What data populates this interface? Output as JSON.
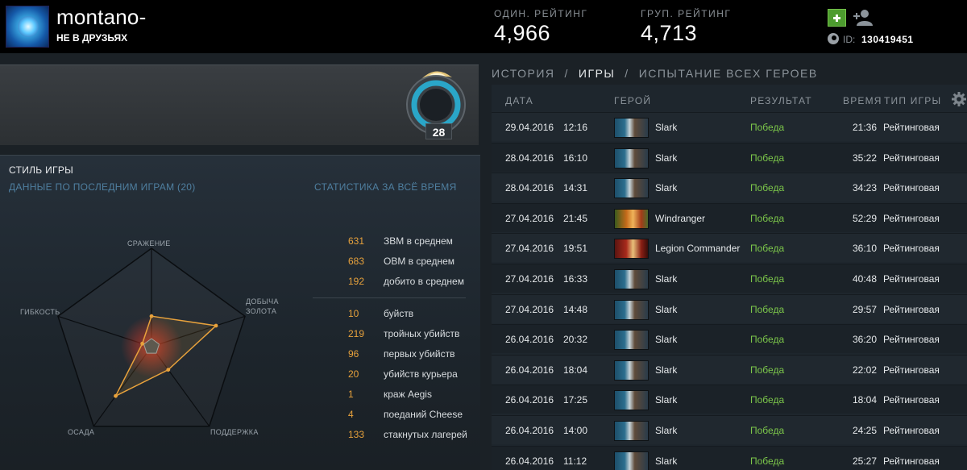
{
  "header": {
    "username": "montano-",
    "friend_status": "НЕ В ДРУЗЬЯХ",
    "solo_rating_label": "ОДИН. РЕЙТИНГ",
    "solo_rating_value": "4,966",
    "party_rating_label": "ГРУП. РЕЙТИНГ",
    "party_rating_value": "4,713",
    "id_label": "ID:",
    "id_value": "130419451"
  },
  "badge": {
    "level": "28"
  },
  "play_style": {
    "title": "СТИЛЬ ИГРЫ",
    "subtitle": "ДАННЫЕ ПО ПОСЛЕДНИМ ИГРАМ (20)",
    "axes": {
      "fighting": "СРАЖЕНИЕ",
      "farming_line1": "ДОБЫЧА",
      "farming_line2": "ЗОЛОТА",
      "support": "ПОДДЕРЖКА",
      "pushing": "ОСАДА",
      "versatility": "ГИБКОСТЬ"
    },
    "values": {
      "fighting": 0.31,
      "farming": 0.69,
      "support": 0.29,
      "pushing": 0.62,
      "versatility": 0.07
    }
  },
  "alltime": {
    "title": "СТАТИСТИКА ЗА ВСЁ ВРЕМЯ",
    "averages": [
      {
        "value": "631",
        "label": "ЗВМ в среднем"
      },
      {
        "value": "683",
        "label": "ОВМ в среднем"
      },
      {
        "value": "192",
        "label": "добито в среднем"
      }
    ],
    "totals": [
      {
        "value": "10",
        "label": "буйств"
      },
      {
        "value": "219",
        "label": "тройных убийств"
      },
      {
        "value": "96",
        "label": "первых убийств"
      },
      {
        "value": "20",
        "label": "убийств курьера"
      },
      {
        "value": "1",
        "label": "краж Aegis"
      },
      {
        "value": "4",
        "label": "поеданий Cheese"
      },
      {
        "value": "133",
        "label": "стакнутых лагерей"
      }
    ]
  },
  "nav": {
    "history": "ИСТОРИЯ",
    "separator": "/",
    "games": "ИГРЫ",
    "all_hero": "ИСПЫТАНИЕ ВСЕХ ГЕРОЕВ"
  },
  "columns": {
    "date": "ДАТА",
    "hero": "ГЕРОЙ",
    "result": "РЕЗУЛЬТАТ",
    "duration": "ВРЕМЯ",
    "type": "ТИП ИГРЫ"
  },
  "matches": [
    {
      "date": "29.04.2016",
      "time": "12:16",
      "hero": "Slark",
      "hero_icon": "slark-portrait",
      "result": "Победа",
      "duration": "21:36",
      "type": "Рейтинговая"
    },
    {
      "date": "28.04.2016",
      "time": "16:10",
      "hero": "Slark",
      "hero_icon": "slark-portrait",
      "result": "Победа",
      "duration": "35:22",
      "type": "Рейтинговая"
    },
    {
      "date": "28.04.2016",
      "time": "14:31",
      "hero": "Slark",
      "hero_icon": "slark-portrait",
      "result": "Победа",
      "duration": "34:23",
      "type": "Рейтинговая"
    },
    {
      "date": "27.04.2016",
      "time": "21:45",
      "hero": "Windranger",
      "hero_icon": "windranger-portrait",
      "result": "Победа",
      "duration": "52:29",
      "type": "Рейтинговая"
    },
    {
      "date": "27.04.2016",
      "time": "19:51",
      "hero": "Legion Commander",
      "hero_icon": "legion-commander-portrait",
      "result": "Победа",
      "duration": "36:10",
      "type": "Рейтинговая"
    },
    {
      "date": "27.04.2016",
      "time": "16:33",
      "hero": "Slark",
      "hero_icon": "slark-portrait",
      "result": "Победа",
      "duration": "40:48",
      "type": "Рейтинговая"
    },
    {
      "date": "27.04.2016",
      "time": "14:48",
      "hero": "Slark",
      "hero_icon": "slark-portrait",
      "result": "Победа",
      "duration": "29:57",
      "type": "Рейтинговая"
    },
    {
      "date": "26.04.2016",
      "time": "20:32",
      "hero": "Slark",
      "hero_icon": "slark-portrait",
      "result": "Победа",
      "duration": "36:20",
      "type": "Рейтинговая"
    },
    {
      "date": "26.04.2016",
      "time": "18:04",
      "hero": "Slark",
      "hero_icon": "slark-portrait",
      "result": "Победа",
      "duration": "22:02",
      "type": "Рейтинговая"
    },
    {
      "date": "26.04.2016",
      "time": "17:25",
      "hero": "Slark",
      "hero_icon": "slark-portrait",
      "result": "Победа",
      "duration": "18:04",
      "type": "Рейтинговая"
    },
    {
      "date": "26.04.2016",
      "time": "14:00",
      "hero": "Slark",
      "hero_icon": "slark-portrait",
      "result": "Победа",
      "duration": "24:25",
      "type": "Рейтинговая"
    },
    {
      "date": "26.04.2016",
      "time": "11:12",
      "hero": "Slark",
      "hero_icon": "slark-portrait",
      "result": "Победа",
      "duration": "25:27",
      "type": "Рейтинговая"
    }
  ],
  "colors": {
    "win": "#7cc74a",
    "accent_orange": "#e8a23c",
    "subtitle_blue": "#4f7fa0"
  }
}
